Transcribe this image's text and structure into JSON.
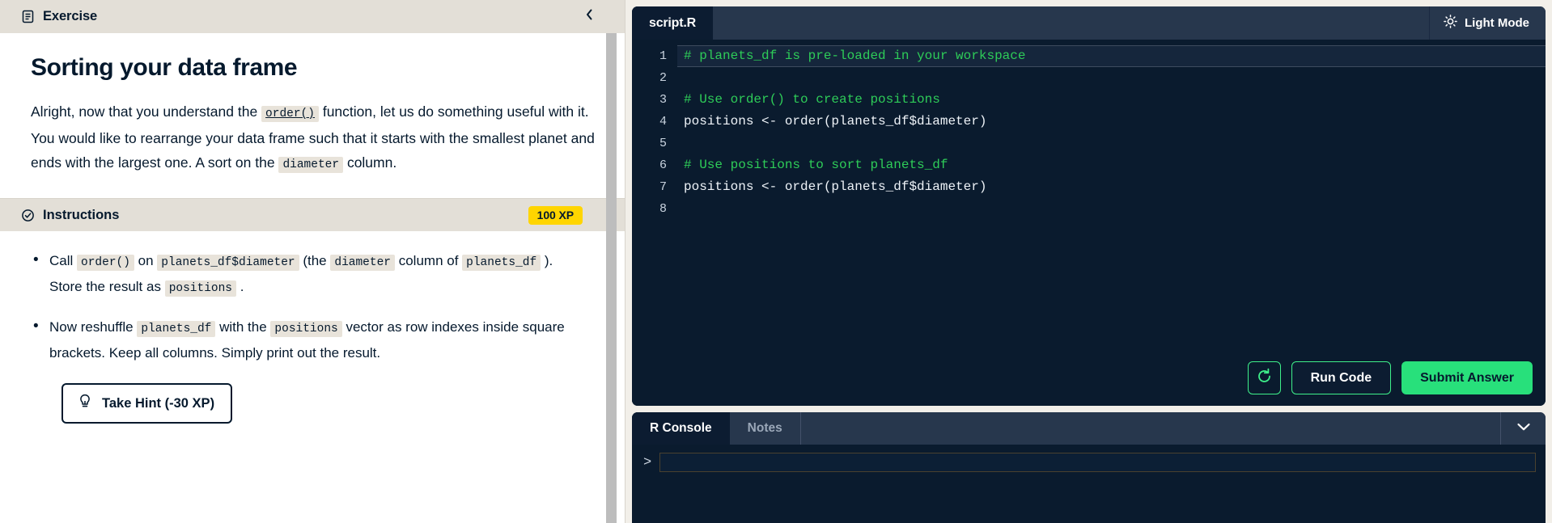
{
  "left": {
    "exercise_header": {
      "title": "Exercise",
      "icon": "document-icon",
      "collapse_icon": "chevron-left-icon"
    },
    "lesson": {
      "heading": "Sorting your data frame",
      "paragraph_parts": [
        {
          "type": "text",
          "value": "Alright, now that you understand the "
        },
        {
          "type": "code_underline",
          "value": "order()"
        },
        {
          "type": "text",
          "value": " function, let us do something useful with it. You would like to rearrange your data frame such that it starts with the smallest planet and ends with the largest one. A sort on the "
        },
        {
          "type": "code",
          "value": "diameter"
        },
        {
          "type": "text",
          "value": " column."
        }
      ]
    },
    "instructions_header": {
      "title": "Instructions",
      "icon": "check-circle-icon",
      "xp_badge": "100 XP"
    },
    "instructions": [
      [
        {
          "type": "text",
          "value": "Call "
        },
        {
          "type": "code",
          "value": "order()"
        },
        {
          "type": "text",
          "value": " on "
        },
        {
          "type": "code",
          "value": "planets_df$diameter"
        },
        {
          "type": "text",
          "value": " (the "
        },
        {
          "type": "code",
          "value": "diameter"
        },
        {
          "type": "text",
          "value": " column of "
        },
        {
          "type": "code",
          "value": "planets_df"
        },
        {
          "type": "text",
          "value": " ). Store the result as "
        },
        {
          "type": "code",
          "value": "positions"
        },
        {
          "type": "text",
          "value": " ."
        }
      ],
      [
        {
          "type": "text",
          "value": "Now reshuffle "
        },
        {
          "type": "code",
          "value": "planets_df"
        },
        {
          "type": "text",
          "value": " with the "
        },
        {
          "type": "code",
          "value": "positions"
        },
        {
          "type": "text",
          "value": " vector as row indexes inside square brackets. Keep all columns. Simply print out the result."
        }
      ]
    ],
    "hint_button": {
      "label": "Take Hint (-30 XP)",
      "icon": "lightbulb-icon"
    }
  },
  "editor": {
    "file_tab": "script.R",
    "light_mode": {
      "label": "Light Mode",
      "icon": "sun-icon"
    },
    "line_numbers": [
      "1",
      "2",
      "3",
      "4",
      "5",
      "6",
      "7",
      "8"
    ],
    "lines": [
      {
        "num": "1",
        "highlight": true,
        "tokens": [
          {
            "cls": "tok-comment",
            "t": "# planets_df is pre-loaded in your workspace"
          }
        ]
      },
      {
        "num": "2",
        "highlight": false,
        "tokens": [
          {
            "cls": "tok-plain",
            "t": ""
          }
        ]
      },
      {
        "num": "3",
        "highlight": false,
        "tokens": [
          {
            "cls": "tok-comment",
            "t": "# Use order() to create positions"
          }
        ]
      },
      {
        "num": "4",
        "highlight": false,
        "tokens": [
          {
            "cls": "tok-plain",
            "t": "positions <- order(planets_df$diameter)"
          }
        ]
      },
      {
        "num": "5",
        "highlight": false,
        "tokens": [
          {
            "cls": "tok-plain",
            "t": ""
          }
        ]
      },
      {
        "num": "6",
        "highlight": false,
        "tokens": [
          {
            "cls": "tok-comment",
            "t": "# Use positions to sort planets_df"
          }
        ]
      },
      {
        "num": "7",
        "highlight": false,
        "tokens": [
          {
            "cls": "tok-plain",
            "t": "positions <- order(planets_df$diameter)"
          }
        ]
      },
      {
        "num": "8",
        "highlight": false,
        "tokens": [
          {
            "cls": "tok-plain",
            "t": ""
          }
        ]
      }
    ],
    "actions": {
      "reset_icon": "reset-circular-arrow-icon",
      "run_label": "Run Code",
      "submit_label": "Submit Answer"
    }
  },
  "console": {
    "tabs": [
      {
        "label": "R Console",
        "active": true
      },
      {
        "label": "Notes",
        "active": false
      }
    ],
    "collapse_icon": "chevron-down-icon",
    "prompt": ">",
    "input_value": "",
    "input_placeholder": ""
  },
  "colors": {
    "accent_green": "#28e07b",
    "outline_green": "#3ef08a",
    "xp_yellow": "#ffd500",
    "comment_green": "#2ecc58",
    "dark_navy": "#0a1b2e",
    "tabbar_navy": "#27374d",
    "panel_beige": "#e3dfd7"
  }
}
